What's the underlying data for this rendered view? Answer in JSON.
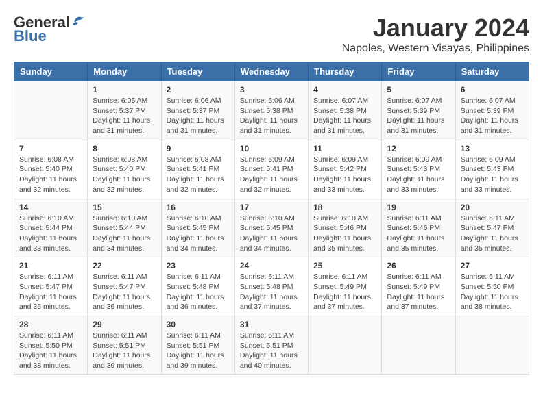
{
  "logo": {
    "general": "General",
    "blue": "Blue"
  },
  "title": "January 2024",
  "location": "Napoles, Western Visayas, Philippines",
  "days_header": [
    "Sunday",
    "Monday",
    "Tuesday",
    "Wednesday",
    "Thursday",
    "Friday",
    "Saturday"
  ],
  "weeks": [
    [
      {
        "day": "",
        "sunrise": "",
        "sunset": "",
        "daylight": ""
      },
      {
        "day": "1",
        "sunrise": "Sunrise: 6:05 AM",
        "sunset": "Sunset: 5:37 PM",
        "daylight": "Daylight: 11 hours and 31 minutes."
      },
      {
        "day": "2",
        "sunrise": "Sunrise: 6:06 AM",
        "sunset": "Sunset: 5:37 PM",
        "daylight": "Daylight: 11 hours and 31 minutes."
      },
      {
        "day": "3",
        "sunrise": "Sunrise: 6:06 AM",
        "sunset": "Sunset: 5:38 PM",
        "daylight": "Daylight: 11 hours and 31 minutes."
      },
      {
        "day": "4",
        "sunrise": "Sunrise: 6:07 AM",
        "sunset": "Sunset: 5:38 PM",
        "daylight": "Daylight: 11 hours and 31 minutes."
      },
      {
        "day": "5",
        "sunrise": "Sunrise: 6:07 AM",
        "sunset": "Sunset: 5:39 PM",
        "daylight": "Daylight: 11 hours and 31 minutes."
      },
      {
        "day": "6",
        "sunrise": "Sunrise: 6:07 AM",
        "sunset": "Sunset: 5:39 PM",
        "daylight": "Daylight: 11 hours and 31 minutes."
      }
    ],
    [
      {
        "day": "7",
        "sunrise": "Sunrise: 6:08 AM",
        "sunset": "Sunset: 5:40 PM",
        "daylight": "Daylight: 11 hours and 32 minutes."
      },
      {
        "day": "8",
        "sunrise": "Sunrise: 6:08 AM",
        "sunset": "Sunset: 5:40 PM",
        "daylight": "Daylight: 11 hours and 32 minutes."
      },
      {
        "day": "9",
        "sunrise": "Sunrise: 6:08 AM",
        "sunset": "Sunset: 5:41 PM",
        "daylight": "Daylight: 11 hours and 32 minutes."
      },
      {
        "day": "10",
        "sunrise": "Sunrise: 6:09 AM",
        "sunset": "Sunset: 5:41 PM",
        "daylight": "Daylight: 11 hours and 32 minutes."
      },
      {
        "day": "11",
        "sunrise": "Sunrise: 6:09 AM",
        "sunset": "Sunset: 5:42 PM",
        "daylight": "Daylight: 11 hours and 33 minutes."
      },
      {
        "day": "12",
        "sunrise": "Sunrise: 6:09 AM",
        "sunset": "Sunset: 5:43 PM",
        "daylight": "Daylight: 11 hours and 33 minutes."
      },
      {
        "day": "13",
        "sunrise": "Sunrise: 6:09 AM",
        "sunset": "Sunset: 5:43 PM",
        "daylight": "Daylight: 11 hours and 33 minutes."
      }
    ],
    [
      {
        "day": "14",
        "sunrise": "Sunrise: 6:10 AM",
        "sunset": "Sunset: 5:44 PM",
        "daylight": "Daylight: 11 hours and 33 minutes."
      },
      {
        "day": "15",
        "sunrise": "Sunrise: 6:10 AM",
        "sunset": "Sunset: 5:44 PM",
        "daylight": "Daylight: 11 hours and 34 minutes."
      },
      {
        "day": "16",
        "sunrise": "Sunrise: 6:10 AM",
        "sunset": "Sunset: 5:45 PM",
        "daylight": "Daylight: 11 hours and 34 minutes."
      },
      {
        "day": "17",
        "sunrise": "Sunrise: 6:10 AM",
        "sunset": "Sunset: 5:45 PM",
        "daylight": "Daylight: 11 hours and 34 minutes."
      },
      {
        "day": "18",
        "sunrise": "Sunrise: 6:10 AM",
        "sunset": "Sunset: 5:46 PM",
        "daylight": "Daylight: 11 hours and 35 minutes."
      },
      {
        "day": "19",
        "sunrise": "Sunrise: 6:11 AM",
        "sunset": "Sunset: 5:46 PM",
        "daylight": "Daylight: 11 hours and 35 minutes."
      },
      {
        "day": "20",
        "sunrise": "Sunrise: 6:11 AM",
        "sunset": "Sunset: 5:47 PM",
        "daylight": "Daylight: 11 hours and 35 minutes."
      }
    ],
    [
      {
        "day": "21",
        "sunrise": "Sunrise: 6:11 AM",
        "sunset": "Sunset: 5:47 PM",
        "daylight": "Daylight: 11 hours and 36 minutes."
      },
      {
        "day": "22",
        "sunrise": "Sunrise: 6:11 AM",
        "sunset": "Sunset: 5:47 PM",
        "daylight": "Daylight: 11 hours and 36 minutes."
      },
      {
        "day": "23",
        "sunrise": "Sunrise: 6:11 AM",
        "sunset": "Sunset: 5:48 PM",
        "daylight": "Daylight: 11 hours and 36 minutes."
      },
      {
        "day": "24",
        "sunrise": "Sunrise: 6:11 AM",
        "sunset": "Sunset: 5:48 PM",
        "daylight": "Daylight: 11 hours and 37 minutes."
      },
      {
        "day": "25",
        "sunrise": "Sunrise: 6:11 AM",
        "sunset": "Sunset: 5:49 PM",
        "daylight": "Daylight: 11 hours and 37 minutes."
      },
      {
        "day": "26",
        "sunrise": "Sunrise: 6:11 AM",
        "sunset": "Sunset: 5:49 PM",
        "daylight": "Daylight: 11 hours and 37 minutes."
      },
      {
        "day": "27",
        "sunrise": "Sunrise: 6:11 AM",
        "sunset": "Sunset: 5:50 PM",
        "daylight": "Daylight: 11 hours and 38 minutes."
      }
    ],
    [
      {
        "day": "28",
        "sunrise": "Sunrise: 6:11 AM",
        "sunset": "Sunset: 5:50 PM",
        "daylight": "Daylight: 11 hours and 38 minutes."
      },
      {
        "day": "29",
        "sunrise": "Sunrise: 6:11 AM",
        "sunset": "Sunset: 5:51 PM",
        "daylight": "Daylight: 11 hours and 39 minutes."
      },
      {
        "day": "30",
        "sunrise": "Sunrise: 6:11 AM",
        "sunset": "Sunset: 5:51 PM",
        "daylight": "Daylight: 11 hours and 39 minutes."
      },
      {
        "day": "31",
        "sunrise": "Sunrise: 6:11 AM",
        "sunset": "Sunset: 5:51 PM",
        "daylight": "Daylight: 11 hours and 40 minutes."
      },
      {
        "day": "",
        "sunrise": "",
        "sunset": "",
        "daylight": ""
      },
      {
        "day": "",
        "sunrise": "",
        "sunset": "",
        "daylight": ""
      },
      {
        "day": "",
        "sunrise": "",
        "sunset": "",
        "daylight": ""
      }
    ]
  ]
}
